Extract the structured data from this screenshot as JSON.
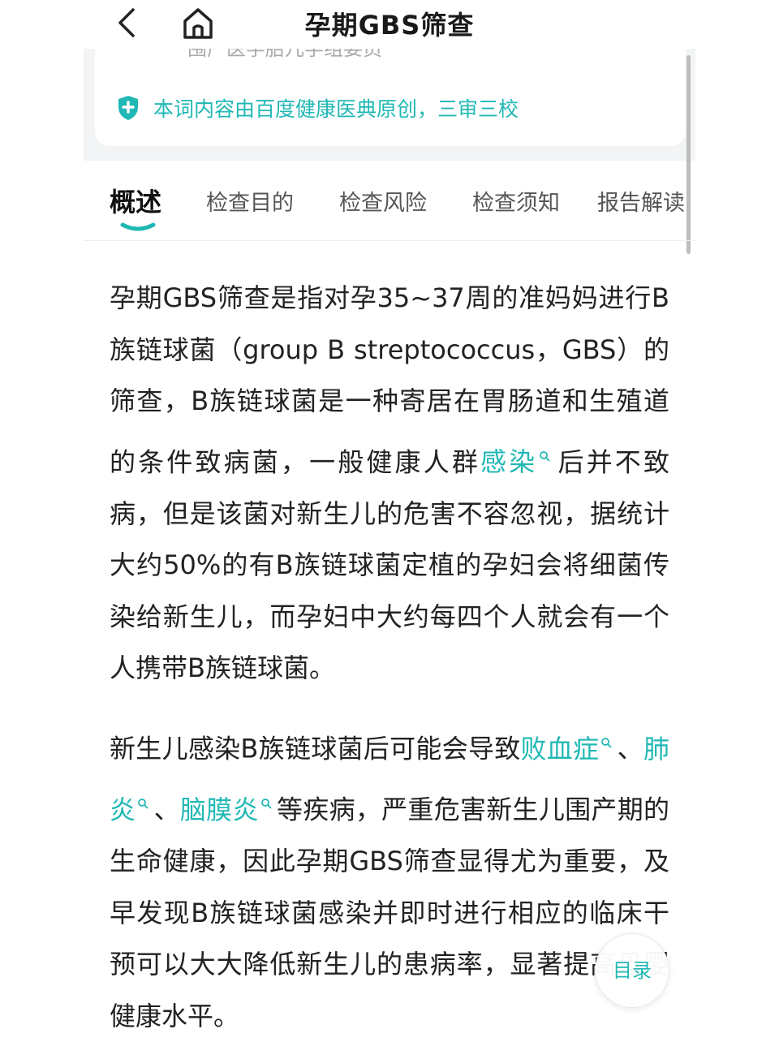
{
  "nav": {
    "title": "孕期GBS筛查",
    "back_icon": "chevron-left-icon",
    "home_icon": "home-icon"
  },
  "card": {
    "cut_text": "围产医学胎儿学组委员",
    "origin_text": "本词内容由百度健康医典原创，三审三校",
    "badge_icon": "shield-plus-icon",
    "accent": "#20b8b4"
  },
  "tabs": [
    {
      "label": "概述",
      "active": true
    },
    {
      "label": "检查目的"
    },
    {
      "label": "检查风险"
    },
    {
      "label": "检查须知"
    },
    {
      "label": "报告解读"
    }
  ],
  "content": {
    "p1": {
      "l1": "孕期GBS筛查是指对孕35~37周的准妈妈进行B族链球菌（group B streptococcus，GBS）的筛查，B族链球菌是一种寄居在胃肠道和生殖道的条件致病菌，一般健康人群",
      "link": "感染",
      "l2": "后并不致病，但是该菌对新生儿的危害不容忽视，据统计大约50%的有B族链球菌定植的孕妇会将细菌传染给新生儿，而孕妇中大约每四个人就会有一个人携带B族链球菌。"
    },
    "p2": {
      "t1": "新生儿感染B族链球菌后可能会导致",
      "link1": "败血症",
      "t2": "、",
      "link2": "肺炎",
      "t3": "、",
      "link3": "脑膜炎",
      "t4": "等疾病，严重危害新生儿围产期的生命健康，因此孕期GBS筛查显得尤为重要，及早发现B族链球菌感染并即时进行相应的临床干预可以大大降低新生儿的患病率，显著提高母婴健康水平。"
    }
  },
  "toc_label": "目录",
  "link_icon": "search-icon"
}
